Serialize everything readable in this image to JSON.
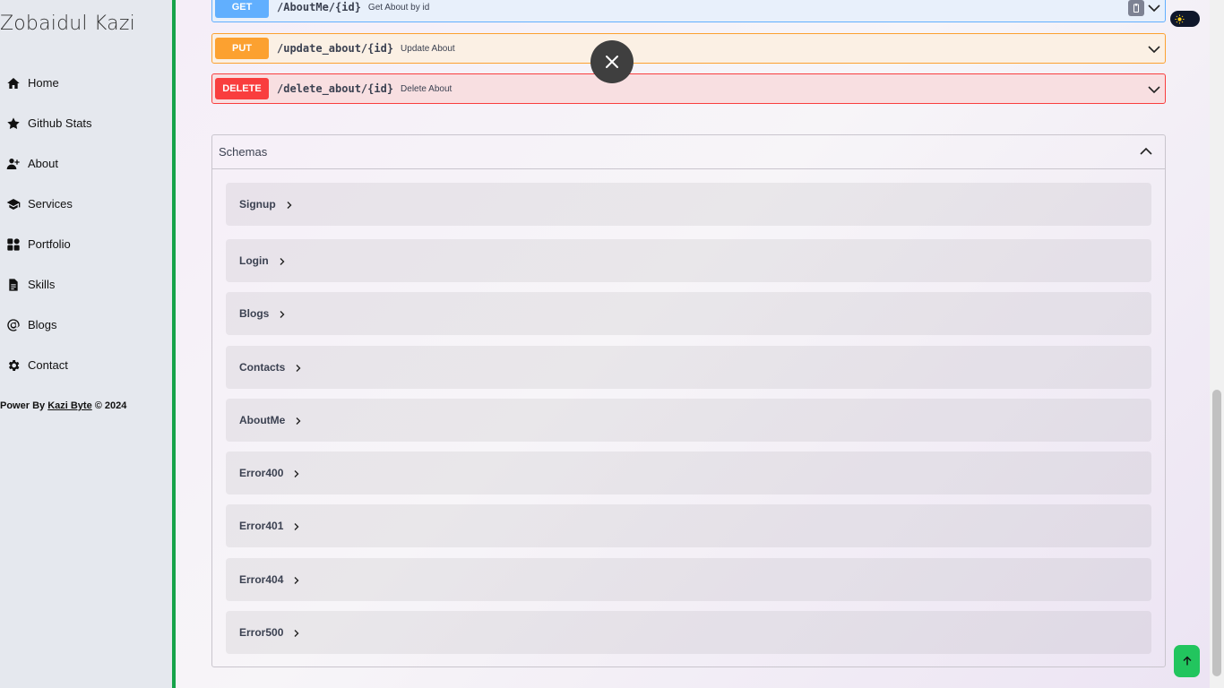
{
  "sidebar": {
    "brand": "Zobaidul Kazi",
    "items": [
      {
        "label": "Home",
        "icon": "home-icon"
      },
      {
        "label": "Github Stats",
        "icon": "star-icon"
      },
      {
        "label": "About",
        "icon": "user-plus-icon"
      },
      {
        "label": "Services",
        "icon": "graduation-cap-icon"
      },
      {
        "label": "Portfolio",
        "icon": "grid-icon"
      },
      {
        "label": "Skills",
        "icon": "file-icon"
      },
      {
        "label": "Blogs",
        "icon": "at-icon"
      },
      {
        "label": "Contact",
        "icon": "gear-icon"
      }
    ],
    "footer": {
      "prefix": "Power By ",
      "link": "Kazi Byte",
      "suffix": " © 2024"
    },
    "border_color": "#16a34a"
  },
  "operations": [
    {
      "method": "GET",
      "path": "/AboutMe/{id}",
      "summary": "Get About by id",
      "color": "#61affe"
    },
    {
      "method": "PUT",
      "path": "/update_about/{id}",
      "summary": "Update About",
      "color": "#fca130"
    },
    {
      "method": "DELETE",
      "path": "/delete_about/{id}",
      "summary": "Delete About",
      "color": "#f93e3e"
    }
  ],
  "schemas": {
    "title": "Schemas",
    "models": [
      "Signup",
      "Login",
      "Blogs",
      "Contacts",
      "AboutMe",
      "Error400",
      "Error401",
      "Error404",
      "Error500"
    ]
  },
  "controls": {
    "close_icon": "close-icon",
    "theme_icon": "sun-icon",
    "scroll_top_icon": "arrow-up-icon",
    "scroll_top_color": "#22c55e"
  }
}
